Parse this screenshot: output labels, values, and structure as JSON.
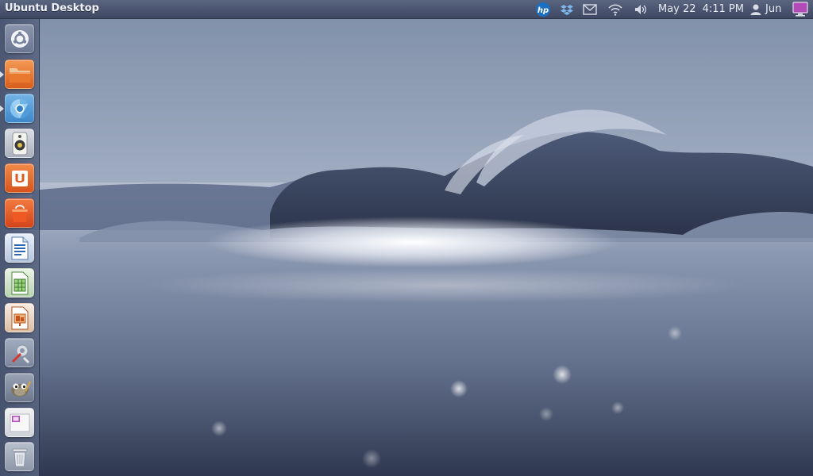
{
  "top_panel": {
    "title": "Ubuntu Desktop",
    "tray": {
      "date": "May 22",
      "time": "4:11 PM",
      "user": "Jun",
      "icons": [
        "hp-icon",
        "dropbox-icon",
        "mail-icon",
        "wifi-icon",
        "volume-icon",
        "user-icon",
        "session-icon"
      ]
    }
  },
  "launcher": {
    "items": [
      {
        "name": "dash-home",
        "icon": "ubuntu-logo-icon",
        "running": false
      },
      {
        "name": "files",
        "icon": "folder-icon",
        "running": true
      },
      {
        "name": "chromium",
        "icon": "browser-icon",
        "running": true
      },
      {
        "name": "rhythmbox",
        "icon": "speaker-icon",
        "running": false
      },
      {
        "name": "ubuntu-one",
        "icon": "ubuntu-one-icon",
        "running": false
      },
      {
        "name": "software-center",
        "icon": "shopping-bag-icon",
        "running": false
      },
      {
        "name": "writer",
        "icon": "document-icon",
        "running": false
      },
      {
        "name": "calc",
        "icon": "spreadsheet-icon",
        "running": false
      },
      {
        "name": "impress",
        "icon": "presentation-icon",
        "running": false
      },
      {
        "name": "system-settings",
        "icon": "wrench-icon",
        "running": false
      },
      {
        "name": "gimp",
        "icon": "gimp-icon",
        "running": false
      },
      {
        "name": "workspace-switcher",
        "icon": "workspaces-icon",
        "running": false
      },
      {
        "name": "trash",
        "icon": "trash-icon",
        "running": false
      }
    ]
  },
  "colors": {
    "panel": "#4a5470",
    "launcher": "#56627e",
    "accent_orange": "#e8702a"
  }
}
